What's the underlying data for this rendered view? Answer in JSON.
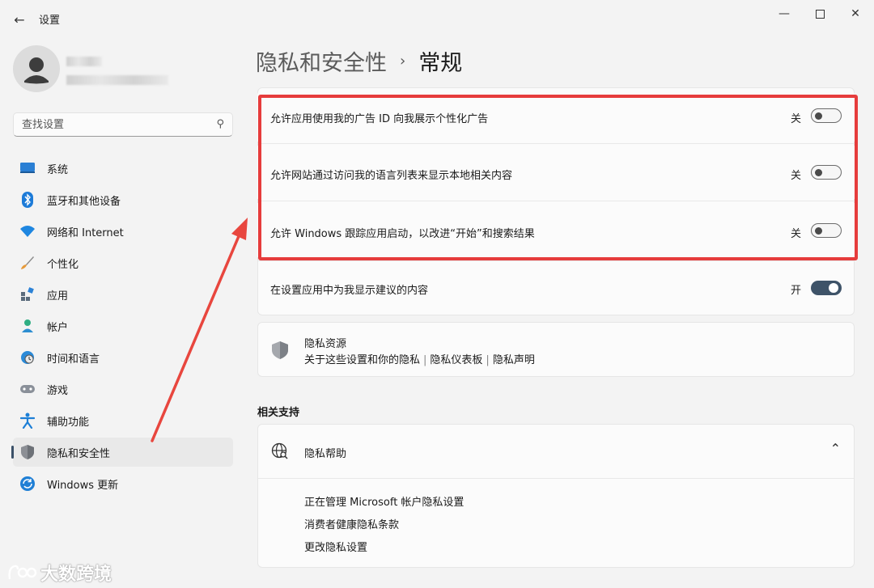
{
  "window": {
    "title": "设置",
    "controls": [
      "minimize-icon",
      "maximize-icon",
      "close-icon"
    ]
  },
  "sidebar": {
    "search": {
      "placeholder": "查找设置"
    },
    "items": [
      {
        "label": "系统",
        "icon": "system-icon",
        "active": false
      },
      {
        "label": "蓝牙和其他设备",
        "icon": "bluetooth-icon",
        "active": false
      },
      {
        "label": "网络和 Internet",
        "icon": "wifi-icon",
        "active": false
      },
      {
        "label": "个性化",
        "icon": "brush-icon",
        "active": false
      },
      {
        "label": "应用",
        "icon": "apps-icon",
        "active": false
      },
      {
        "label": "帐户",
        "icon": "person-icon",
        "active": false
      },
      {
        "label": "时间和语言",
        "icon": "globe-clock-icon",
        "active": false
      },
      {
        "label": "游戏",
        "icon": "gamepad-icon",
        "active": false
      },
      {
        "label": "辅助功能",
        "icon": "accessibility-icon",
        "active": false
      },
      {
        "label": "隐私和安全性",
        "icon": "shield-icon",
        "active": true
      },
      {
        "label": "Windows 更新",
        "icon": "update-icon",
        "active": false
      }
    ]
  },
  "header": {
    "parent": "隐私和安全性",
    "current": "常规"
  },
  "settings": [
    {
      "label": "允许应用使用我的广告 ID 向我展示个性化广告",
      "state": "关",
      "on": false
    },
    {
      "label": "允许网站通过访问我的语言列表来显示本地相关内容",
      "state": "关",
      "on": false
    },
    {
      "label": "允许 Windows 跟踪应用启动，以改进“开始”和搜索结果",
      "state": "关",
      "on": false
    },
    {
      "label": "在设置应用中为我显示建议的内容",
      "state": "开",
      "on": true
    }
  ],
  "privacy_resources": {
    "title": "隐私资源",
    "links": [
      "关于这些设置和你的隐私",
      "隐私仪表板",
      "隐私声明"
    ]
  },
  "related_support": {
    "section_title": "相关支持",
    "help_title": "隐私帮助",
    "links": [
      "正在管理 Microsoft 帐户隐私设置",
      "消费者健康隐私条款",
      "更改隐私设置"
    ]
  },
  "watermark": "大数跨境",
  "colors": {
    "accent": "#3e5368",
    "highlight_frame": "#e63c3c",
    "arrow": "#e8463e"
  }
}
